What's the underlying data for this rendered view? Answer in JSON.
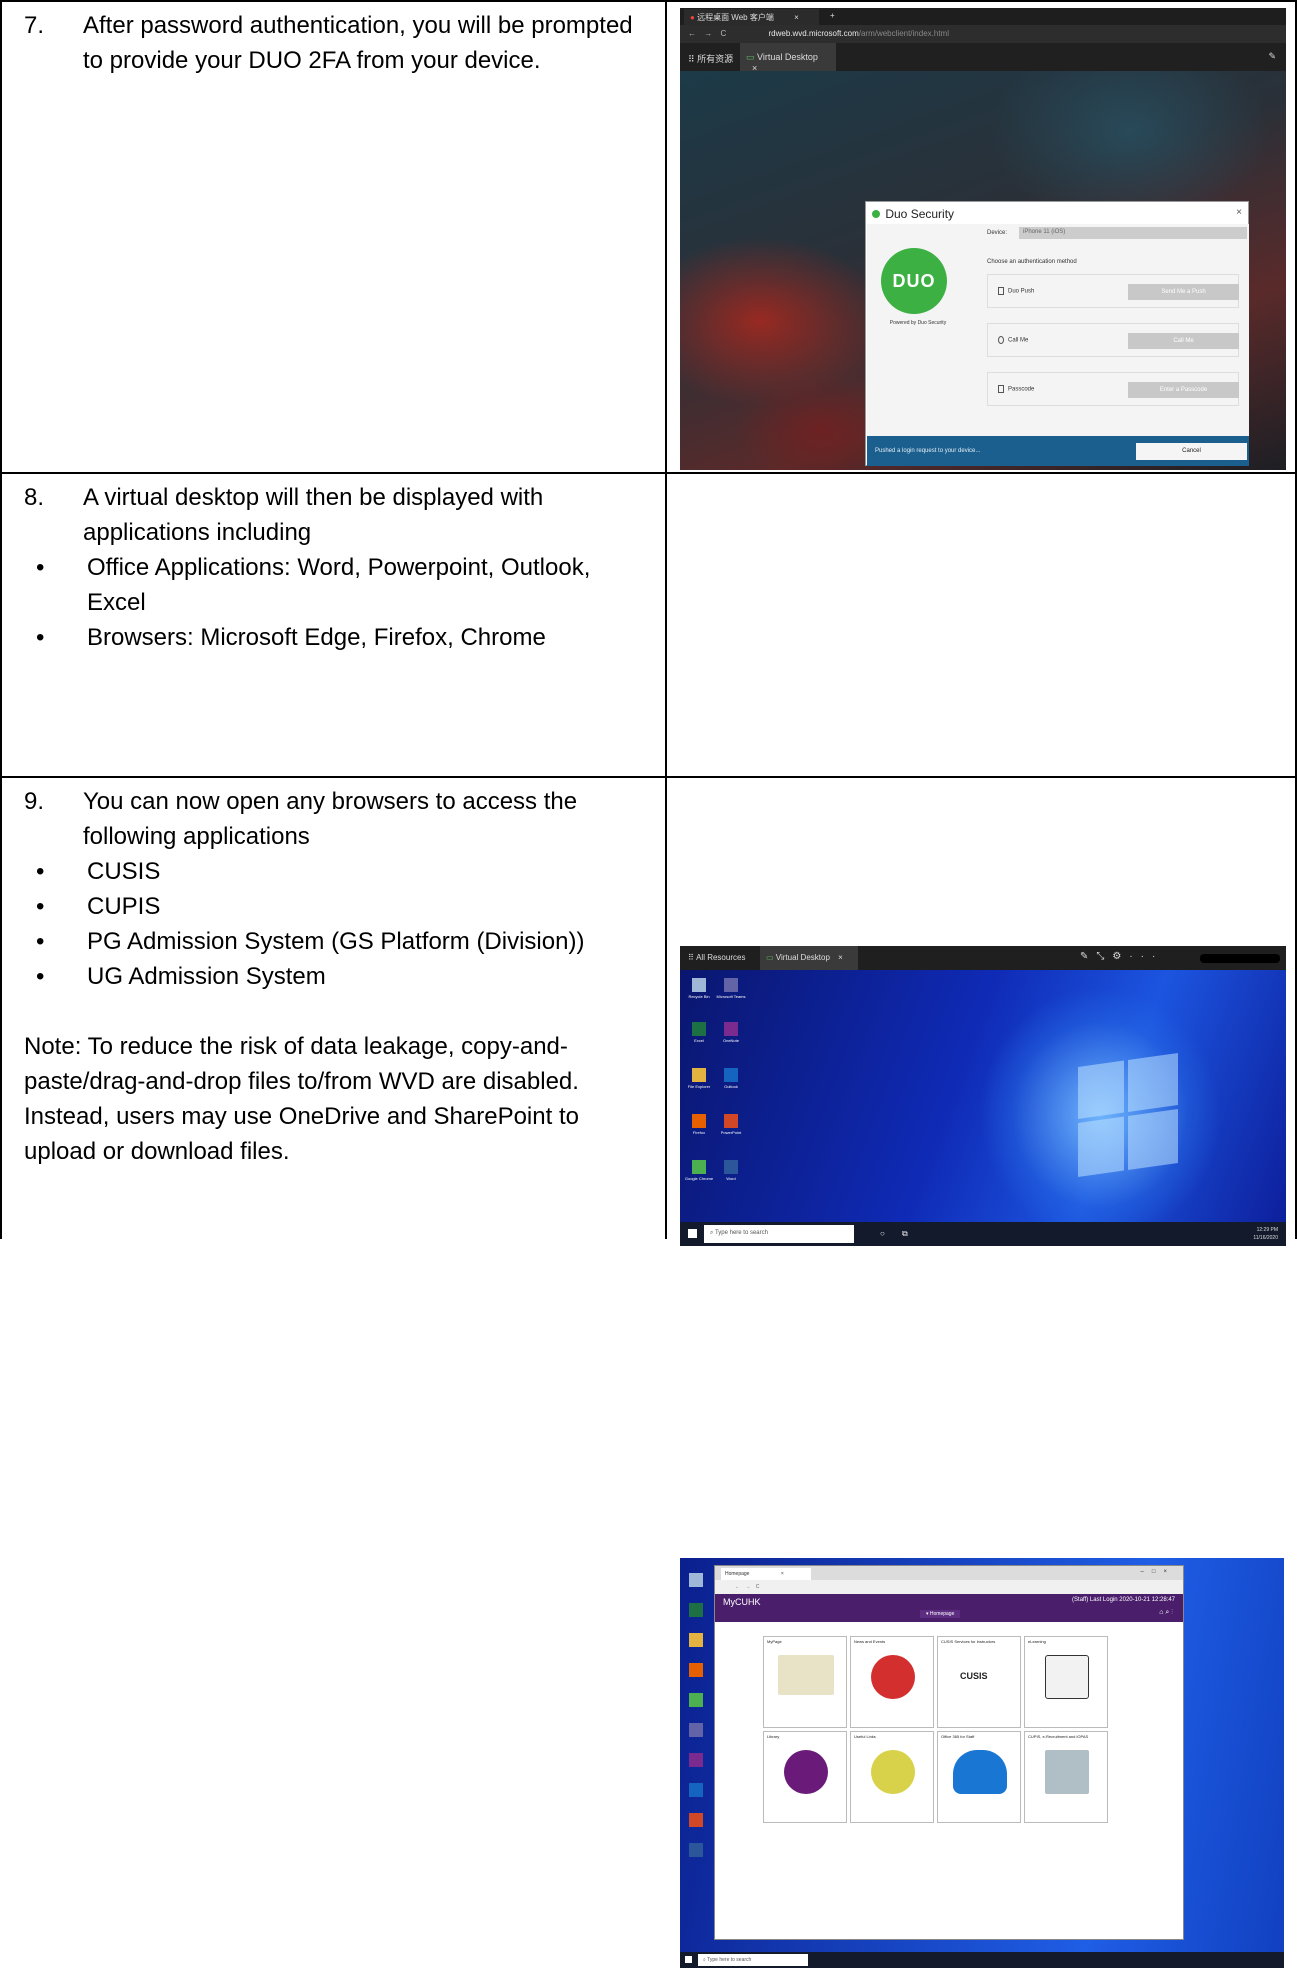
{
  "steps": {
    "s7": {
      "num": "7.",
      "text": "After password authentication, you will be prompted to provide your DUO 2FA from your device."
    },
    "s8": {
      "num": "8.",
      "text": "A virtual desktop will then be displayed with applications including",
      "bullets": [
        "Office Applications: Word, Powerpoint, Outlook, Excel",
        "Browsers: Microsoft Edge, Firefox, Chrome"
      ]
    },
    "s9": {
      "num": "9.",
      "text": "You can now open any browsers to access the following applications",
      "bullets": [
        "CUSIS",
        "CUPIS",
        "PG Admission System (GS Platform (Division))",
        "UG Admission System"
      ],
      "note": "Note: To reduce the risk of data leakage, copy-and-paste/drag-and-drop files to/from WVD are disabled. Instead, users may use OneDrive and SharePoint to upload or download files."
    }
  },
  "screenshot1": {
    "chrome_tab": "远程桌面 Web 客户端",
    "url_host": "rdweb.wvd.microsoft.com",
    "url_path": "/arm/webclient/index.html",
    "all_resources": "所有资源",
    "vd_tab": "Virtual Desktop",
    "duo": {
      "title": "Duo Security",
      "logo_text": "DUO",
      "powered_by": "Powered by Duo Security",
      "device_label": "Device:",
      "device_value": "iPhone 11 (iOS)",
      "choose_method": "Choose an authentication method",
      "options": [
        {
          "label": "Duo Push",
          "button": "Send Me a Push"
        },
        {
          "label": "Call Me",
          "button": "Call Me"
        },
        {
          "label": "Passcode",
          "button": "Enter a Passcode"
        }
      ],
      "status": "Pushed a login request to your device...",
      "cancel": "Cancel"
    }
  },
  "screenshot2": {
    "all_resources": "All Resources",
    "vd_tab": "Virtual Desktop",
    "desktop_icons": [
      "Recycle Bin",
      "Microsoft Teams",
      "Excel",
      "OneNote",
      "File Explorer",
      "Outlook",
      "Firefox",
      "PowerPoint",
      "Google Chrome",
      "Word"
    ],
    "search_placeholder": "Type here to search",
    "time": "12:29 PM",
    "date": "11/16/2020"
  },
  "screenshot3": {
    "tab": "Homepage",
    "brand": "MyCUHK",
    "login_info": "(Staff) Last Login 2020-10-21 12:28:47",
    "homepage_label": "Homepage",
    "tiles": [
      "MyPage",
      "News and Events",
      "CUSIS Services for Instructors",
      "eLearning",
      "Library",
      "Useful Links",
      "Office 365 for Staff",
      "CUPIS, e-Recruitment and iOPAS"
    ],
    "cusis_logo": "CUSIS",
    "search_placeholder": "Type here to search"
  }
}
